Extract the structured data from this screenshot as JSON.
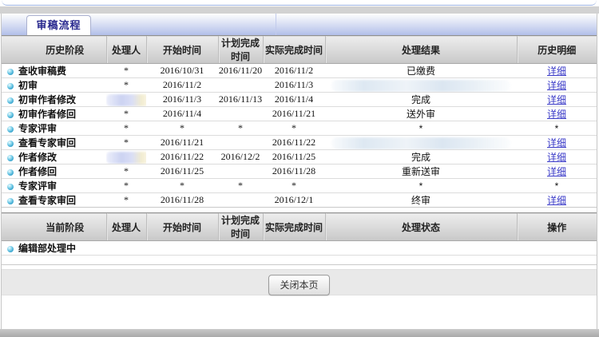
{
  "tab": {
    "label": "审稿流程"
  },
  "history": {
    "columns": [
      "历史阶段",
      "处理人",
      "开始时间",
      "计划完成时间",
      "实际完成时间",
      "处理结果",
      "历史明细"
    ],
    "detail_link_label": "详细",
    "rows": [
      {
        "stage": "查收审稿费",
        "handler": "*",
        "start": "2016/10/31",
        "planned": "2016/11/20",
        "actual": "2016/11/2",
        "result": "已缴费",
        "detail": "详细",
        "detail_link": true
      },
      {
        "stage": "初审",
        "handler": "*",
        "start": "2016/11/2",
        "planned": "",
        "actual": "2016/11/3",
        "result": "",
        "result_redacted": true,
        "detail": "详细",
        "detail_link": true
      },
      {
        "stage": "初审作者修改",
        "handler": "",
        "handler_redacted": true,
        "start": "2016/11/3",
        "planned": "2016/11/13",
        "actual": "2016/11/4",
        "result": "完成",
        "detail": "详细",
        "detail_link": true
      },
      {
        "stage": "初审作者修回",
        "handler": "*",
        "start": "2016/11/4",
        "planned": "",
        "actual": "2016/11/21",
        "result": "送外审",
        "detail": "详细",
        "detail_link": true
      },
      {
        "stage": "专家评审",
        "handler": "*",
        "start": "*",
        "planned": "*",
        "actual": "*",
        "result": "*",
        "detail": "*",
        "detail_link": false
      },
      {
        "stage": "查看专家审回",
        "handler": "*",
        "start": "2016/11/21",
        "planned": "",
        "actual": "2016/11/22",
        "result": "",
        "result_redacted": true,
        "detail": "详细",
        "detail_link": true
      },
      {
        "stage": "作者修改",
        "handler": "",
        "handler_redacted": true,
        "start": "2016/11/22",
        "planned": "2016/12/2",
        "actual": "2016/11/25",
        "result": "完成",
        "detail": "详细",
        "detail_link": true
      },
      {
        "stage": "作者修回",
        "handler": "*",
        "start": "2016/11/25",
        "planned": "",
        "actual": "2016/11/28",
        "result": "重新送审",
        "detail": "详细",
        "detail_link": true
      },
      {
        "stage": "专家评审",
        "handler": "*",
        "start": "*",
        "planned": "*",
        "actual": "*",
        "result": "*",
        "detail": "*",
        "detail_link": false
      },
      {
        "stage": "查看专家审回",
        "handler": "*",
        "start": "2016/11/28",
        "planned": "",
        "actual": "2016/12/1",
        "result": "终审",
        "detail": "详细",
        "detail_link": true
      }
    ]
  },
  "current": {
    "columns": [
      "当前阶段",
      "处理人",
      "开始时间",
      "计划完成时间",
      "实际完成时间",
      "处理状态",
      "操作"
    ],
    "rows": [
      {
        "stage": "编辑部处理中",
        "handler": "",
        "start": "",
        "planned": "",
        "actual": "",
        "result": "",
        "detail": "",
        "detail_link": false
      }
    ]
  },
  "footer": {
    "close_button": "关闭本页"
  },
  "colors": {
    "link": "#3b3bc8",
    "tab_text": "#28288e",
    "bullet": "#2f9ec9"
  }
}
